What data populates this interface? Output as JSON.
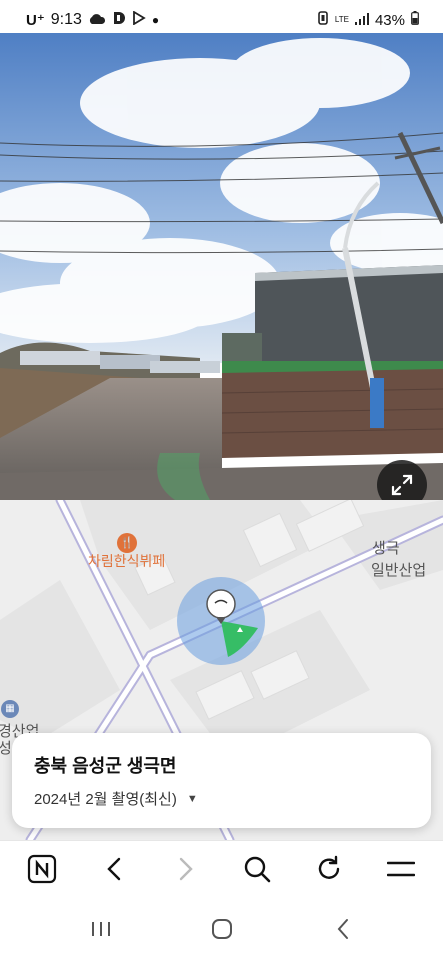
{
  "status_bar": {
    "carrier": "U⁺",
    "time": "9:13",
    "network": "LTE",
    "battery": "43%"
  },
  "map": {
    "poi_name": "차림한식뷔페",
    "label_right_line1": "생극",
    "label_right_line2": "일반산업",
    "label_left_line1": "경산업",
    "label_left_line2": "성그"
  },
  "card": {
    "title": "충북 음성군 생극면",
    "subtitle": "2024년 2월 촬영(최신)"
  },
  "icons": {
    "cloud": "cloud-icon",
    "expand": "expand-icon",
    "naver": "naver-logo-icon",
    "back": "back-icon",
    "forward": "forward-icon",
    "search": "search-icon",
    "refresh": "refresh-icon",
    "menu": "menu-icon"
  }
}
